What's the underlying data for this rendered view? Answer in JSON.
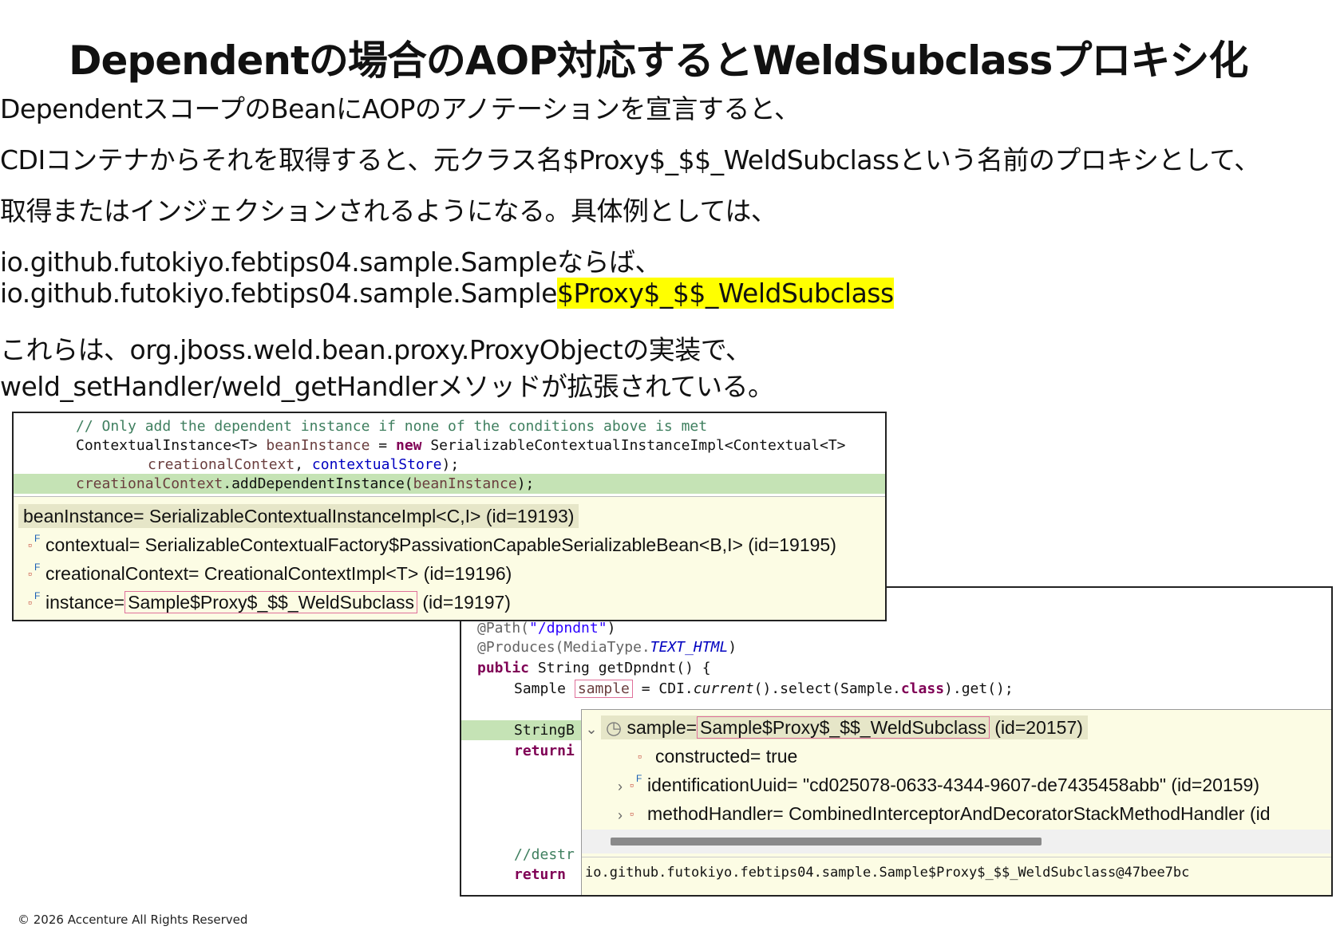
{
  "title": "Dependentの場合のAOP対応するとWeldSubclassプロキシ化",
  "body": {
    "line1": "DependentスコープのBeanにAOPのアノテーションを宣言すると、",
    "line2": "CDIコンテナからそれを取得すると、元クラス名$Proxy$_$$_WeldSubclassという名前のプロキシとして、",
    "line3": "取得またはインジェクションされるようになる。具体例としては、",
    "line4": "io.github.futokiyo.febtips04.sample.Sampleならば、",
    "line5_prefix": "io.github.futokiyo.febtips04.sample.Sample",
    "line5_highlight": "$Proxy$_$$_WeldSubclass",
    "line6": "これらは、org.jboss.weld.bean.proxy.ProxyObjectの実装で、",
    "line7": "weld_setHandler/weld_getHandlerメソッドが拡張されている。"
  },
  "code1": {
    "l1": "// Only add the dependent instance if none of the conditions above is met",
    "l2a": "ContextualInstance<T> ",
    "l2b": "beanInstance",
    "l2c": " = ",
    "l2d": "new",
    "l2e": " SerializableContextualInstanceImpl<Contextual<T>",
    "l3a": "creationalContext",
    "l3b": ", ",
    "l3c": "contextualStore",
    "l3d": ");",
    "l4a": "creationalContext",
    "l4b": ".addDependentInstance(",
    "l4c": "beanInstance",
    "l4d": ");"
  },
  "tip1": {
    "row1": "beanInstance= SerializableContextualInstanceImpl<C,I>  (id=19193)",
    "row2": "contextual= SerializableContextualFactory$PassivationCapableSerializableBean<B,I>  (id=19195)",
    "row3": "creationalContext= CreationalContextImpl<T>  (id=19196)",
    "row4_label": "instance=",
    "row4_value": "Sample$Proxy$_$$_WeldSubclass",
    "row4_id": "(id=19197)"
  },
  "code2": {
    "l1a": "@Path(",
    "l1b": "\"/dpndnt\"",
    "l1c": ")",
    "l2a": "@Produces(MediaType.",
    "l2b": "TEXT_HTML",
    "l2c": ")",
    "l3a": "public",
    "l3b": " String getDpndnt() {",
    "l4a": "Sample ",
    "l4b": "sample",
    "l4c": " = CDI.",
    "l4d": "current",
    "l4e": "().select(Sample.",
    "l4f": "class",
    "l4g": ").get();",
    "l5": "StringB",
    "l6": "returni",
    "l7": "//destr",
    "l8": "return"
  },
  "tip2": {
    "row1_label": "sample=",
    "row1_value": "Sample$Proxy$_$$_WeldSubclass",
    "row1_id": "(id=20157)",
    "row2": "constructed= true",
    "row3": "identificationUuid= \"cd025078-0633-4344-9607-de7435458abb\" (id=20159)",
    "row4": "methodHandler= CombinedInterceptorAndDecoratorStackMethodHandler  (id",
    "detail": "io.github.futokiyo.febtips04.sample.Sample$Proxy$_$$_WeldSubclass@47bee7bc"
  },
  "footer": "© 2026 Accenture All Rights Reserved"
}
